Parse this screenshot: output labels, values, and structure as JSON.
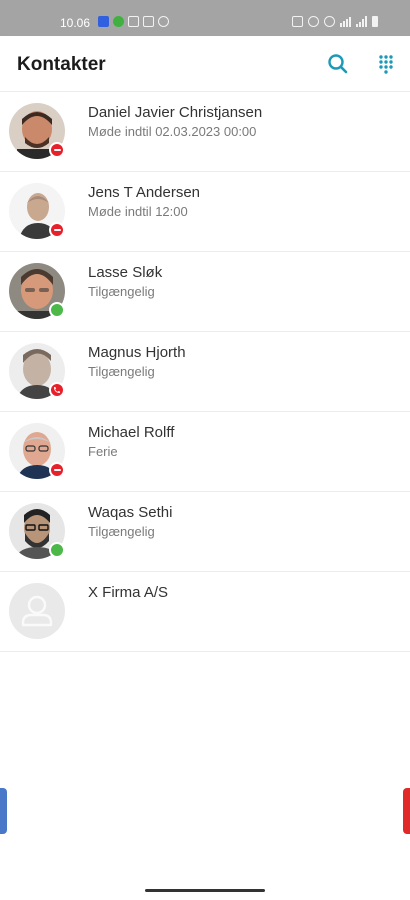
{
  "status_bar": {
    "time": "10.06"
  },
  "app_bar": {
    "title": "Kontakter",
    "icons": [
      "search-icon",
      "dialpad-icon"
    ],
    "accent_color": "#1a9ab8"
  },
  "contacts": [
    {
      "name": "Daniel Javier Christjansen",
      "status": "Møde indtil 02.03.2023 00:00",
      "presence": "busy"
    },
    {
      "name": "Jens T Andersen",
      "status": "Møde indtil 12:00",
      "presence": "busy"
    },
    {
      "name": "Lasse Sløk",
      "status": "Tilgængelig",
      "presence": "available"
    },
    {
      "name": "Magnus Hjorth",
      "status": "Tilgængelig",
      "presence": "on-call"
    },
    {
      "name": "Michael Rolff",
      "status": "Ferie",
      "presence": "busy"
    },
    {
      "name": "Waqas Sethi",
      "status": "Tilgængelig",
      "presence": "available"
    },
    {
      "name": "X Firma A/S",
      "status": "",
      "presence": "none"
    }
  ],
  "colors": {
    "busy": "#e8202a",
    "available": "#4cb848",
    "left_edge_tab": "#4a78c9",
    "right_edge_tab": "#e02a2a"
  }
}
